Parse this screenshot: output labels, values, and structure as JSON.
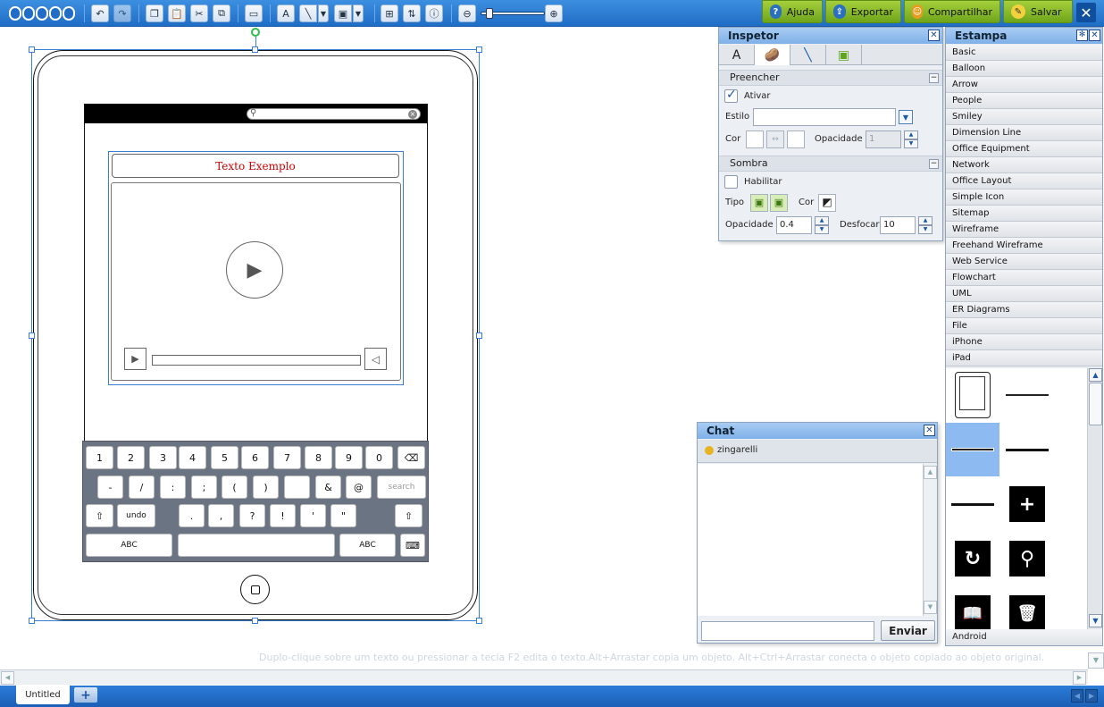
{
  "toolbar": {
    "logo": "cacoo",
    "buttons": [
      {
        "name": "undo-icon",
        "glyph": "↶"
      },
      {
        "name": "redo-icon",
        "glyph": "↷"
      },
      {
        "name": "copy-icon",
        "glyph": "❐"
      },
      {
        "name": "paste-icon",
        "glyph": "📋"
      },
      {
        "name": "cut-icon",
        "glyph": "✂"
      },
      {
        "name": "clone-icon",
        "glyph": "⧉"
      },
      {
        "name": "shape-icon",
        "glyph": "▭"
      },
      {
        "name": "text-icon",
        "glyph": "A"
      },
      {
        "name": "line-icon",
        "glyph": "╲"
      },
      {
        "name": "image-icon",
        "glyph": "▣"
      },
      {
        "name": "group-icon",
        "glyph": "⊞"
      },
      {
        "name": "arrange-icon",
        "glyph": "⇅"
      },
      {
        "name": "info-icon",
        "glyph": "ⓘ"
      },
      {
        "name": "zoom-out-icon",
        "glyph": "⊖"
      },
      {
        "name": "zoom-in-icon",
        "glyph": "⊕"
      }
    ],
    "actions": {
      "help": "Ajuda",
      "export": "Exportar",
      "share": "Compartilhar",
      "save": "Salvar"
    }
  },
  "canvas": {
    "video_title": "Texto Exemplo",
    "keyboard": {
      "row1": [
        "1",
        "2",
        "3",
        "4",
        "5",
        "6",
        "7",
        "8",
        "9",
        "0",
        "⌫"
      ],
      "row2": [
        "-",
        "/",
        ":",
        ";",
        "(",
        ")",
        "",
        "&",
        "@",
        "search"
      ],
      "row3": [
        "⇧",
        "undo",
        ".",
        ",",
        "?",
        "!",
        "'",
        "\"",
        "⇧"
      ],
      "row4": [
        "ABC",
        "",
        "ABC",
        "⌨"
      ]
    }
  },
  "inspector": {
    "title": "Inspetor",
    "tabs": [
      "A",
      "🥔",
      "╲",
      "▣"
    ],
    "fill": {
      "section": "Preencher",
      "enable_label": "Ativar",
      "style_label": "Estilo",
      "color_label": "Cor",
      "opacity_label": "Opacidade",
      "opacity_value": "1"
    },
    "shadow": {
      "section": "Sombra",
      "enable_label": "Habilitar",
      "type_label": "Tipo",
      "color_label": "Cor",
      "opacity_label": "Opacidade",
      "opacity_value": "0.4",
      "blur_label": "Desfocar",
      "blur_value": "10"
    }
  },
  "estampa": {
    "title": "Estampa",
    "categories": [
      "Basic",
      "Balloon",
      "Arrow",
      "People",
      "Smiley",
      "Dimension Line",
      "Office Equipment",
      "Network",
      "Office Layout",
      "Simple Icon",
      "Sitemap",
      "Wireframe",
      "Freehand Wireframe",
      "Web Service",
      "Flowchart",
      "UML",
      "ER Diagrams",
      "File",
      "iPhone",
      "iPad"
    ],
    "last_category": "Android"
  },
  "chat": {
    "title": "Chat",
    "user": "zingarelli",
    "send_label": "Enviar",
    "input_value": ""
  },
  "status": {
    "hint": "Duplo-clique sobre um texto ou pressionar a tecla F2 edita o texto.Alt+Arrastar copia um objeto. Alt+Ctrl+Arrastar conecta o objeto copiado ao objeto original."
  },
  "bottom": {
    "tab": "Untitled",
    "add": "+"
  }
}
